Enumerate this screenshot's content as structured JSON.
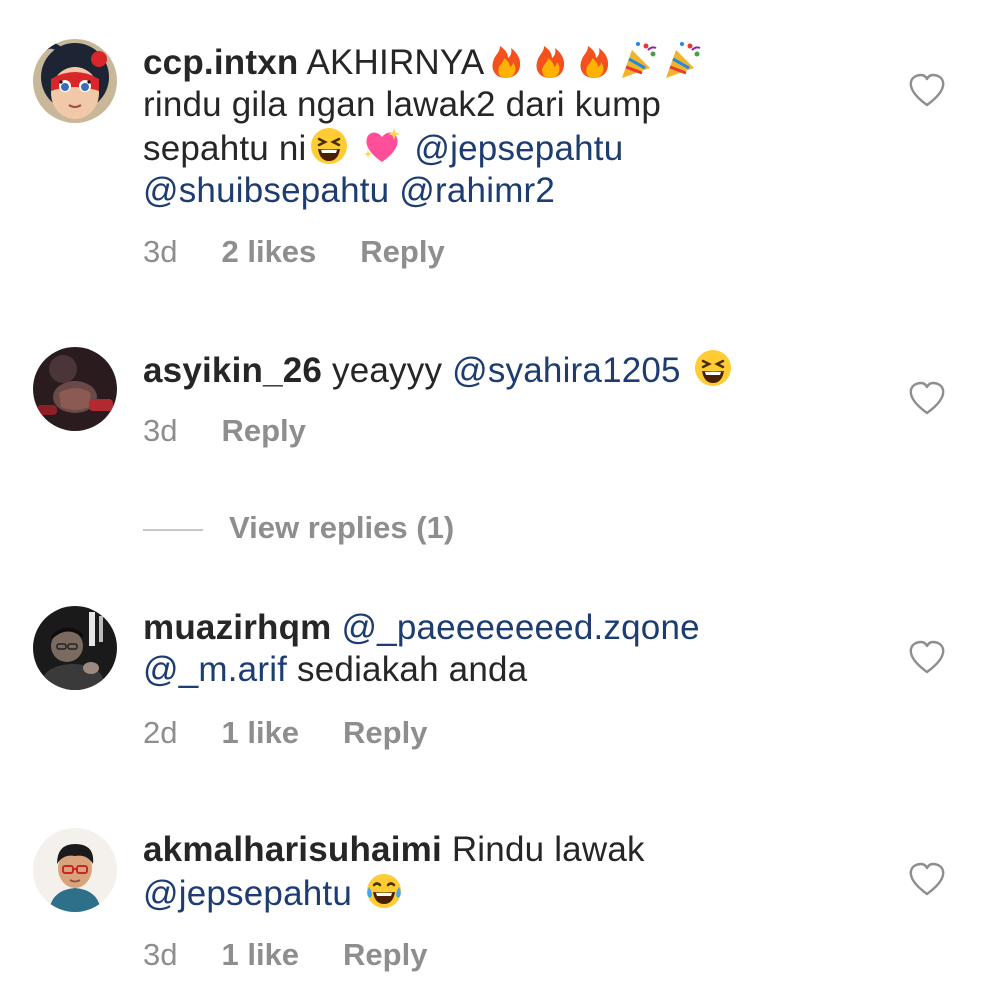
{
  "comments": [
    {
      "username": "ccp.intxn",
      "avatar": "ladybug-cartoon-avatar",
      "text_parts": [
        "AKHIRNYA",
        "rindu gila ngan lawak2 dari kump",
        "sepahtu ni"
      ],
      "mentions": [
        "@jepsepahtu",
        "@shuibsepahtu",
        "@rahimr2"
      ],
      "emojis": [
        "fire-emoji",
        "fire-emoji",
        "fire-emoji",
        "party-popper-emoji",
        "party-popper-emoji",
        "laughing-emoji",
        "sparkling-heart-emoji"
      ],
      "time": "3d",
      "likes": "2 likes",
      "reply": "Reply"
    },
    {
      "username": "asyikin_26",
      "avatar": "hands-avatar",
      "text_parts": [
        "yeayyy"
      ],
      "mentions": [
        "@syahira1205"
      ],
      "emojis": [
        "laughing-emoji"
      ],
      "time": "3d",
      "reply": "Reply",
      "view_replies": "View replies (1)"
    },
    {
      "username": "muazirhqm",
      "avatar": "dark-photo-avatar",
      "text_parts": [
        "sediakah anda"
      ],
      "mentions": [
        "@_paeeeeeeed.zqone",
        "@_m.arif"
      ],
      "time": "2d",
      "likes": "1 like",
      "reply": "Reply"
    },
    {
      "username": "akmalharisuhaimi",
      "avatar": "boy-cartoon-avatar",
      "text_parts": [
        "Rindu lawak"
      ],
      "mentions": [
        "@jepsepahtu"
      ],
      "emojis": [
        "tears-of-joy-emoji"
      ],
      "time": "3d",
      "likes": "1 like",
      "reply": "Reply"
    }
  ],
  "icons": {
    "like": "heart-outline-icon"
  },
  "colors": {
    "text": "#262626",
    "mention": "#1c3c72",
    "meta": "#8e8e8e"
  }
}
